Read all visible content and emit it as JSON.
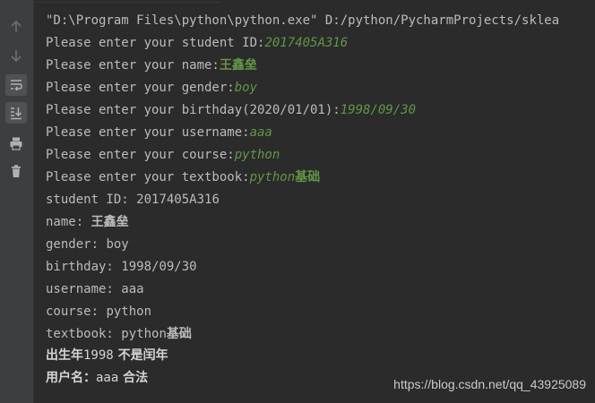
{
  "toolbar": {
    "buttons": [
      {
        "name": "up-arrow-icon",
        "active": false
      },
      {
        "name": "down-arrow-icon",
        "active": false
      },
      {
        "name": "soft-wrap-icon",
        "active": true
      },
      {
        "name": "scroll-to-end-icon",
        "active": true
      },
      {
        "name": "print-icon",
        "active": false
      },
      {
        "name": "trash-icon",
        "active": false
      }
    ]
  },
  "console": {
    "command": "\"D:\\Program Files\\python\\python.exe\" D:/python/PycharmProjects/sklea",
    "prompts": [
      {
        "prompt": "Please enter your student ID:",
        "input": "2017405A316"
      },
      {
        "prompt": "Please enter your name:",
        "input": "王鑫垒"
      },
      {
        "prompt": "Please enter your gender:",
        "input": "boy"
      },
      {
        "prompt": "Please enter your birthday(2020/01/01):",
        "input": "1998/09/30"
      },
      {
        "prompt": "Please enter your username:",
        "input": "aaa"
      },
      {
        "prompt": "Please enter your course:",
        "input": "python"
      },
      {
        "prompt": "Please enter your textbook:",
        "input_latin": "python",
        "input_cjk": "基础"
      }
    ],
    "outputs": [
      {
        "label": "student ID: ",
        "value": "2017405A316"
      },
      {
        "label": "name: ",
        "value": "王鑫垒"
      },
      {
        "label": "gender: ",
        "value": "boy"
      },
      {
        "label": "birthday: ",
        "value": "1998/09/30"
      },
      {
        "label": "username: ",
        "value": "aaa"
      },
      {
        "label": "course: ",
        "value": "python"
      },
      {
        "label": "textbook: ",
        "value_latin": "python",
        "value_cjk": "基础"
      }
    ],
    "summary": {
      "birth_label": "出生年",
      "birth_year": "1998",
      "leap_text": " 不是闰年",
      "user_label": "用户名：",
      "user_value": "aaa",
      "valid_text": " 合法"
    }
  },
  "watermark": "https://blog.csdn.net/qq_43925089",
  "colors": {
    "background": "#2b2b2b",
    "gutter": "#3c3f41",
    "text": "#bbbbbb",
    "user_input": "#619647"
  }
}
